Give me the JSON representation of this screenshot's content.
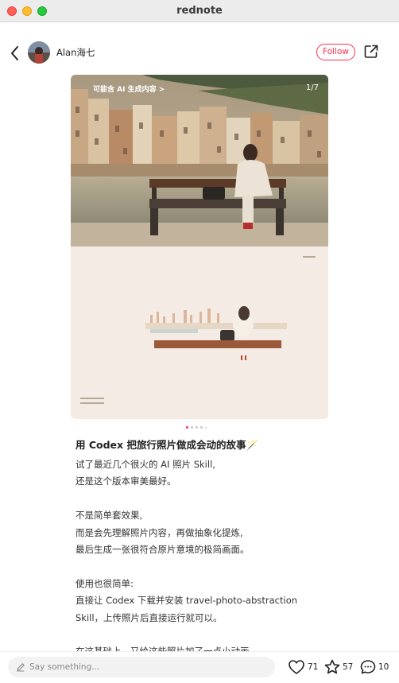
{
  "window": {
    "title": "rednote"
  },
  "header": {
    "author": "Alan海七",
    "follow_label": "Follow"
  },
  "image": {
    "ai_badge": "可能含 AI 生成内容 >",
    "page": "1/7",
    "total_dots": 5,
    "active_dot": 0
  },
  "post": {
    "title": "用 Codex 把旅行照片做成会动的故事🪄",
    "lines": [
      "试了最近几个很火的 AI 照片 Skill,",
      "还是这个版本审美最好。",
      "",
      "不是简单套效果,",
      "而是会先理解照片内容，再做抽象化提炼,",
      "最后生成一张很符合原片意境的极简画面。",
      "",
      "使用也很简单:",
      "直接让 Codex 下载并安装 travel-photo-abstraction",
      "Skill，上传照片后直接运行就可以。",
      "",
      "在这基础上，又给这些照片加了一点小动画,"
    ]
  },
  "bottom": {
    "comment_placeholder": "Say something...",
    "likes": "71",
    "stars": "57",
    "comments": "10"
  }
}
